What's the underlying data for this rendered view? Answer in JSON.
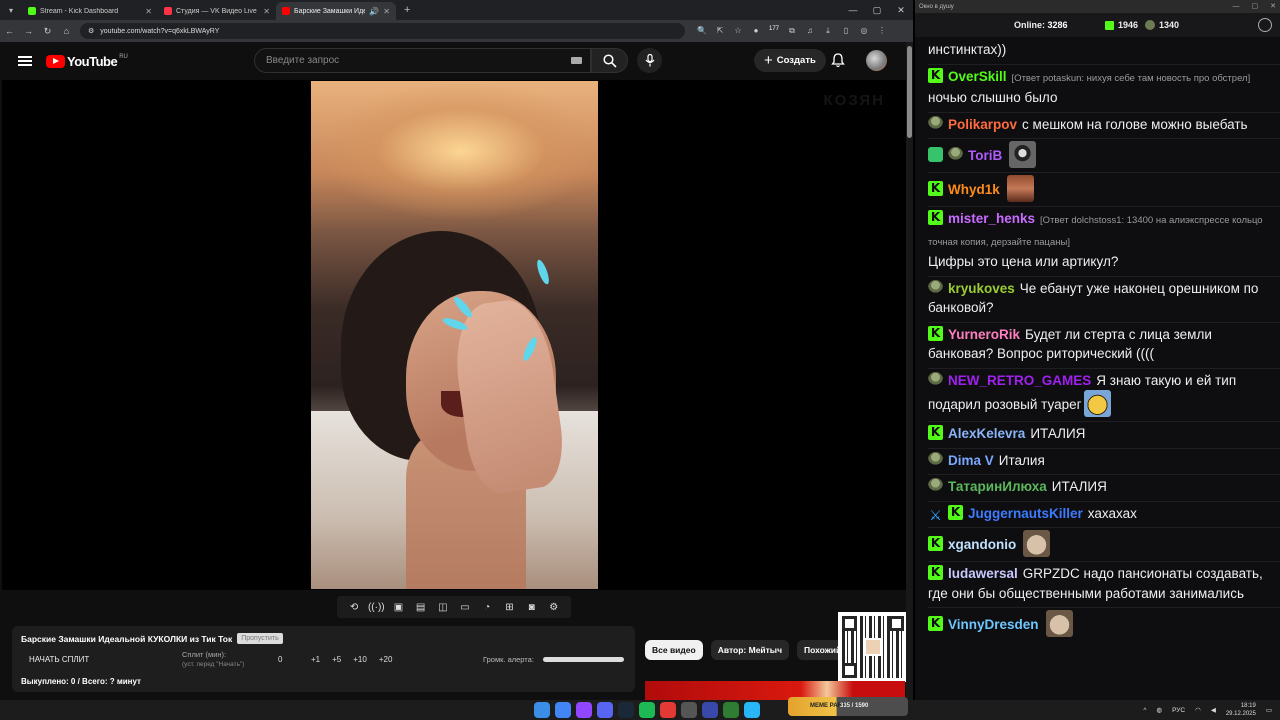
{
  "browser": {
    "tabs": [
      {
        "title": "Stream - Kick Dashboard",
        "favicon_color": "#53fc18",
        "active": false
      },
      {
        "title": "Студия — VK Видео Live",
        "favicon_color": "#ff3347",
        "active": false
      },
      {
        "title": "Барские Замашки Идеальн",
        "favicon_color": "#ff0000",
        "active": true
      }
    ],
    "url": "youtube.com/watch?v=q6xkLBWAyRY",
    "extension_badge": "177"
  },
  "youtube": {
    "logo_text": "YouTube",
    "country_code": "RU",
    "search_placeholder": "Введите запрос",
    "create_label": "Создать",
    "watermark": "КОЗЯН"
  },
  "overlay": {
    "title": "Барские Замашки Идеальной КУКОЛКИ из Тик Ток",
    "skip_label": "Пропустить",
    "start_split": "НАЧАТЬ СПЛИТ",
    "split_label": "Сплит (мин):",
    "split_sub": "(уст. перед \"Начать\")",
    "split_value": "0",
    "increments": [
      "+1",
      "+5",
      "+10",
      "+20"
    ],
    "volume_label": "Громк. алерта:",
    "volume_level": 1.0,
    "bought": "Выкуплено: 0 / Всего: ? минут"
  },
  "chips": [
    "Все видео",
    "Автор: Мейтыч",
    "Похожий к"
  ],
  "chat": {
    "window_title": "Окно в душу",
    "online_label": "Online:",
    "online_count": "3286",
    "kick_count": "1946",
    "other_count": "1340",
    "messages": [
      {
        "badges": [],
        "user": "",
        "color": "",
        "reply": "",
        "text": "инстинктах))",
        "emote": ""
      },
      {
        "badges": [
          "kick"
        ],
        "user": "OverSkill",
        "color": "#53fc18",
        "reply": "[Ответ potaskun: нихуя себе там новость про обстрел]",
        "text": "ночью слышно было",
        "emote": ""
      },
      {
        "badges": [
          "gob"
        ],
        "user": "Polikarpov",
        "color": "#ff6b3d",
        "reply": "",
        "text": "с мешком на голове можно выебать",
        "emote": ""
      },
      {
        "badges": [
          "shield",
          "gob"
        ],
        "user": "ToriB",
        "color": "#b05cff",
        "reply": "",
        "text": "",
        "emote": "e1"
      },
      {
        "badges": [
          "kick"
        ],
        "user": "Whyd1k",
        "color": "#ff8c1a",
        "reply": "",
        "text": "",
        "emote": "e2"
      },
      {
        "badges": [
          "kick"
        ],
        "user": "mister_henks",
        "color": "#c86bff",
        "reply": "[Ответ dolchstoss1: 13400 на алиэкспрессе кольцо точная копия, дерзайте пацаны]",
        "text": "Цифры это цена или артикул?",
        "emote": ""
      },
      {
        "badges": [
          "gob"
        ],
        "user": "kryukoves",
        "color": "#9acd32",
        "reply": "",
        "text": "Че ебанут уже наконец орешником по банковой?",
        "emote": ""
      },
      {
        "badges": [
          "kick"
        ],
        "user": "YurneroRik",
        "color": "#ff7fbf",
        "reply": "",
        "text": "Будет ли стерта с лица земли банковая? Вопрос риторический ((((",
        "emote": ""
      },
      {
        "badges": [
          "gob"
        ],
        "user": "NEW_RETRO_GAMES",
        "color": "#a020f0",
        "reply": "",
        "text": "Я знаю такую и ей тип подарил розовый туарег",
        "emote": "e3"
      },
      {
        "badges": [
          "kick"
        ],
        "user": "AlexKelevra",
        "color": "#8ab4f8",
        "reply": "",
        "text": "ИТАЛИЯ",
        "emote": ""
      },
      {
        "badges": [
          "gob"
        ],
        "user": "Dima V",
        "color": "#7aa7ff",
        "reply": "",
        "text": "Италия",
        "emote": ""
      },
      {
        "badges": [
          "gob"
        ],
        "user": "ТатаринИлюха",
        "color": "#5cb85c",
        "reply": "",
        "text": "ИТАЛИЯ",
        "emote": ""
      },
      {
        "badges": [
          "sword",
          "kick"
        ],
        "user": "JuggernautsKiller",
        "color": "#3d7bff",
        "reply": "",
        "text": "хахахах",
        "emote": ""
      },
      {
        "badges": [
          "kick"
        ],
        "user": "xgandonio",
        "color": "#c0e0ff",
        "reply": "",
        "text": "",
        "emote": "e4"
      },
      {
        "badges": [
          "kick"
        ],
        "user": "ludawersal",
        "color": "#c9c9ff",
        "reply": "",
        "text": "GRPZDC надо пансионаты создавать, где они бы общественными работами занимались",
        "emote": ""
      },
      {
        "badges": [
          "kick"
        ],
        "user": "VinnyDresden",
        "color": "#6ec6ff",
        "reply": "",
        "text": "",
        "emote": "e4"
      }
    ]
  },
  "taskbar": {
    "banner_text": "MEME PARTY",
    "banner_count": "335 / 1590",
    "lang": "РУС",
    "time": "18:19",
    "date": "29.12.2025"
  }
}
